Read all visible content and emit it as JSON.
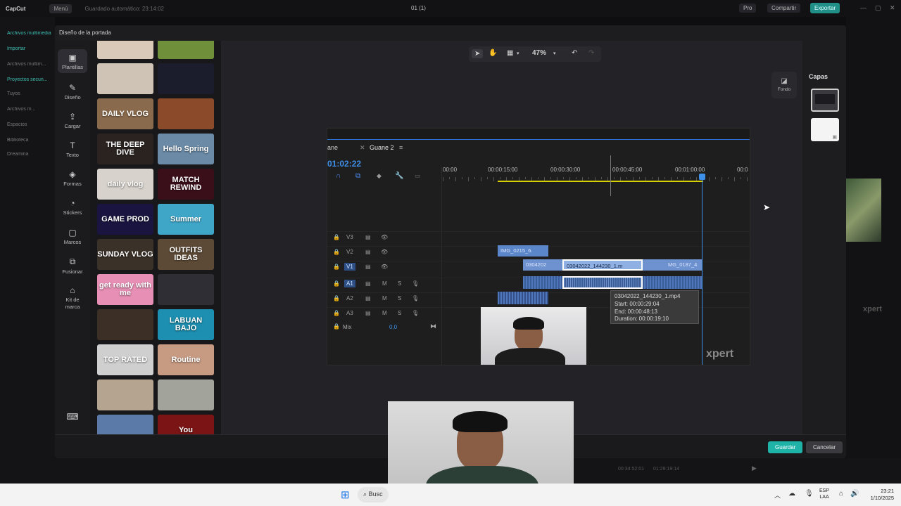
{
  "app": {
    "logo": "CapCut",
    "menu": "Menú",
    "saved": "Guardado automático: 23:14:02",
    "project_title": "01 (1)",
    "pro": "Pro",
    "share": "Compartir",
    "export": "Exportar"
  },
  "bg_sidebar": {
    "items": [
      "Archivos multimedia",
      "Importar",
      "Archivos multim...",
      "Proyectos secun...",
      "Tuyos",
      "Archivos m...",
      "Espacios",
      "Biblioteca",
      "Dreamina"
    ]
  },
  "dialog": {
    "title": "Diseño de la portada",
    "rail": [
      {
        "label": "Plantillas",
        "icon": "templates-icon"
      },
      {
        "label": "Diseño",
        "icon": "design-icon"
      },
      {
        "label": "Cargar",
        "icon": "upload-icon"
      },
      {
        "label": "Texto",
        "icon": "text-icon"
      },
      {
        "label": "Formas",
        "icon": "shapes-icon"
      },
      {
        "label": "Stickers",
        "icon": "stickers-icon"
      },
      {
        "label": "Marcos",
        "icon": "frames-icon"
      },
      {
        "label": "Fusionar",
        "icon": "merge-icon"
      },
      {
        "label": "Kit de marca",
        "icon": "brand-kit-icon"
      }
    ],
    "templates": [
      {
        "text": "",
        "bg": "#d8c9b8"
      },
      {
        "text": "",
        "bg": "#6f8f3a"
      },
      {
        "text": "",
        "bg": "#cfc3b6"
      },
      {
        "text": "",
        "bg": "#1b1c2c"
      },
      {
        "text": "DAILY VLOG",
        "bg": "#8a6a4c"
      },
      {
        "text": "",
        "bg": "#8b4a2a"
      },
      {
        "text": "THE DEEP DIVE",
        "bg": "#2a2320"
      },
      {
        "text": "Hello Spring",
        "bg": "#6a8aa6"
      },
      {
        "text": "daily vlog",
        "bg": "#d8d2cc"
      },
      {
        "text": "MATCH REWIND",
        "bg": "#3a0f1a"
      },
      {
        "text": "GAME PROD",
        "bg": "#1a1440"
      },
      {
        "text": "Summer",
        "bg": "#3fa6c8"
      },
      {
        "text": "SUNDAY VLOG",
        "bg": "#3a3128"
      },
      {
        "text": "OUTFITS IDEAS",
        "bg": "#5d4a36"
      },
      {
        "text": "get ready with me",
        "bg": "#e78fb5"
      },
      {
        "text": "",
        "bg": "#2f2e34"
      },
      {
        "text": "",
        "bg": "#3b2f26"
      },
      {
        "text": "LABUAN BAJO",
        "bg": "#1d8fb0"
      },
      {
        "text": "TOP RATED",
        "bg": "#cfcfcf"
      },
      {
        "text": "Routine",
        "bg": "#c79a82"
      },
      {
        "text": "",
        "bg": "#b5a48f"
      },
      {
        "text": "",
        "bg": "#a2a39b"
      },
      {
        "text": "",
        "bg": "#5c7aa8"
      },
      {
        "text": "You",
        "bg": "#7b1414"
      }
    ],
    "toolbar": {
      "zoom": "47%"
    },
    "side_tool": {
      "label": "Fondo"
    },
    "layers": {
      "title": "Capas"
    },
    "buttons": {
      "save": "Guardar",
      "cancel": "Cancelar"
    }
  },
  "premiere": {
    "tab_partial": "ane",
    "tab_active": "Guane 2",
    "timecode": "01:02:22",
    "ruler": [
      "00:00",
      "00:00:15:00",
      "00:00:30:00",
      "00:00:45:00",
      "00:01:00:00",
      "00:0"
    ],
    "tracks": [
      {
        "name": "V3"
      },
      {
        "name": "V2"
      },
      {
        "name": "V1"
      },
      {
        "name": "A1",
        "m": "M",
        "s": "S"
      },
      {
        "name": "A2",
        "m": "M",
        "s": "S"
      },
      {
        "name": "A3",
        "m": "M",
        "s": "S"
      }
    ],
    "mix": {
      "label": "Mix",
      "value": "0,0"
    },
    "clips": [
      "IMG_0215_6.",
      "0304202",
      "03042022_144230_1.m",
      "MG_0187_4"
    ],
    "tooltip": {
      "name": "03042022_144230_1.mp4",
      "start": "Start: 00:00:29:04",
      "end": "End: 00:00:48:13",
      "duration": "Duration: 00:00:19:10"
    },
    "watermark": "xpert"
  },
  "bg_bottom": {
    "time_a": "00:34:52:01",
    "time_b": "01:29:19:14"
  },
  "taskbar": {
    "search": "Busc",
    "lang": "ESP",
    "region": "LAA",
    "time": "23:21",
    "date": "1/10/2025"
  }
}
